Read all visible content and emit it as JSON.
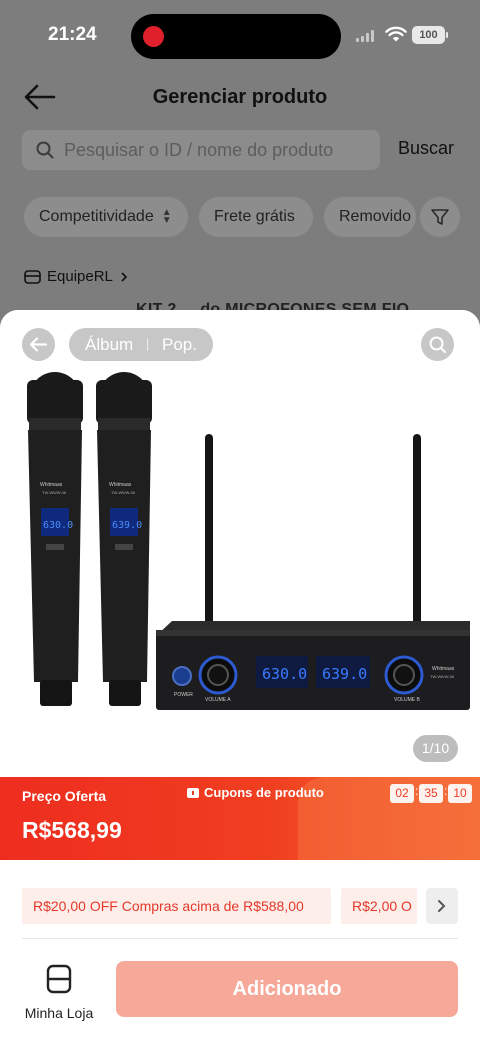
{
  "status_bar": {
    "time": "21:24",
    "battery": "100"
  },
  "header": {
    "title": "Gerenciar produto"
  },
  "search": {
    "placeholder": "Pesquisar o ID / nome do produto",
    "button_label": "Buscar"
  },
  "filters": {
    "chips": [
      "Competitividade",
      "Frete grátis",
      "Removido"
    ]
  },
  "store": {
    "name": "EquipeRL"
  },
  "partial_product_title": "KIT 2 ... do MICROFONES SEM FIO",
  "gallery": {
    "tabs": [
      "Álbum",
      "Pop."
    ],
    "counter": "1/10",
    "product_text": {
      "brand": "Whitmaas",
      "model": "TW-W6/W-06",
      "display_a": "630.0",
      "display_b": "639.0",
      "power": "POWER",
      "volume_a": "VOLUME A",
      "volume_b": "VOLUME B"
    }
  },
  "offer": {
    "label": "Preço Oferta",
    "price": "R$568,99",
    "coupons_label": "Cupons de produto",
    "countdown": {
      "hours": "02",
      "minutes": "35",
      "seconds": "10"
    }
  },
  "promotions": [
    "R$20,00 OFF Compras acima de R$588,00",
    "R$2,00 O"
  ],
  "footer": {
    "my_store_label": "Minha Loja",
    "add_button": "Adicionado"
  },
  "colors": {
    "accent_red": "#ee2d1f",
    "button_disabled": "#f7a999",
    "promo_bg": "#fdeeea"
  }
}
